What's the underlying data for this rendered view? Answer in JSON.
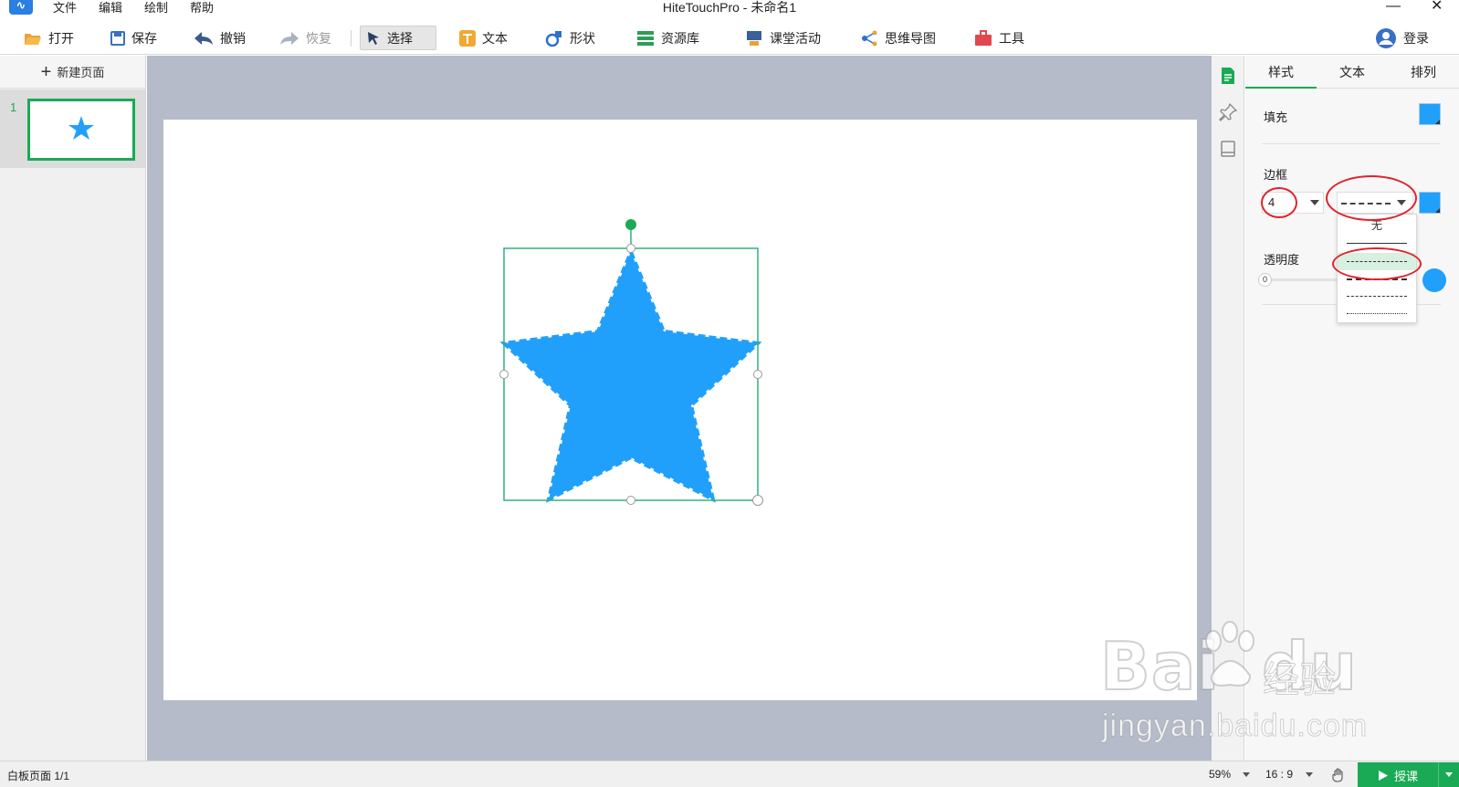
{
  "menu": {
    "items": [
      "文件",
      "编辑",
      "绘制",
      "帮助"
    ]
  },
  "window": {
    "title": "HiteTouchPro - 未命名1",
    "minimize": "—",
    "close": "✕"
  },
  "toolbar": {
    "open": "打开",
    "save": "保存",
    "undo": "撤销",
    "redo": "恢复",
    "select": "选择",
    "text": "文本",
    "shape": "形状",
    "resources": "资源库",
    "activities": "课堂活动",
    "mindmap": "思维导图",
    "tools": "工具",
    "login": "登录"
  },
  "pages_panel": {
    "new_page": "新建页面",
    "thumbnails": [
      {
        "number": "1"
      }
    ]
  },
  "canvas": {
    "shape": "star",
    "fill_color": "#21a0fb",
    "selection_color": "#2db37a",
    "rotate_handle_color": "#1aaa55"
  },
  "properties": {
    "tabs": [
      "样式",
      "文本",
      "排列"
    ],
    "active_tab": "样式",
    "fill_label": "填充",
    "fill_color": "#21a0fb",
    "border_label": "边框",
    "border_width": "4",
    "border_color": "#21a0fb",
    "border_style_selected": "dashed",
    "dropdown_options": [
      {
        "label": "无",
        "style": "none"
      },
      {
        "style": "solid"
      },
      {
        "style": "dashed",
        "selected": true
      },
      {
        "style": "dash-dot-long"
      },
      {
        "style": "dash-dot"
      },
      {
        "style": "dotted"
      }
    ],
    "opacity_label": "透明度",
    "opacity_value": "0",
    "opacity_color": "#21a0fb"
  },
  "status": {
    "page_info": "白板页面 1/1",
    "zoom": "59%",
    "ratio": "16 : 9",
    "teach": "授课"
  },
  "watermark": {
    "brand": "Bai",
    "brand2": "du",
    "cn": "经验",
    "url": "jingyan.baidu.com"
  }
}
